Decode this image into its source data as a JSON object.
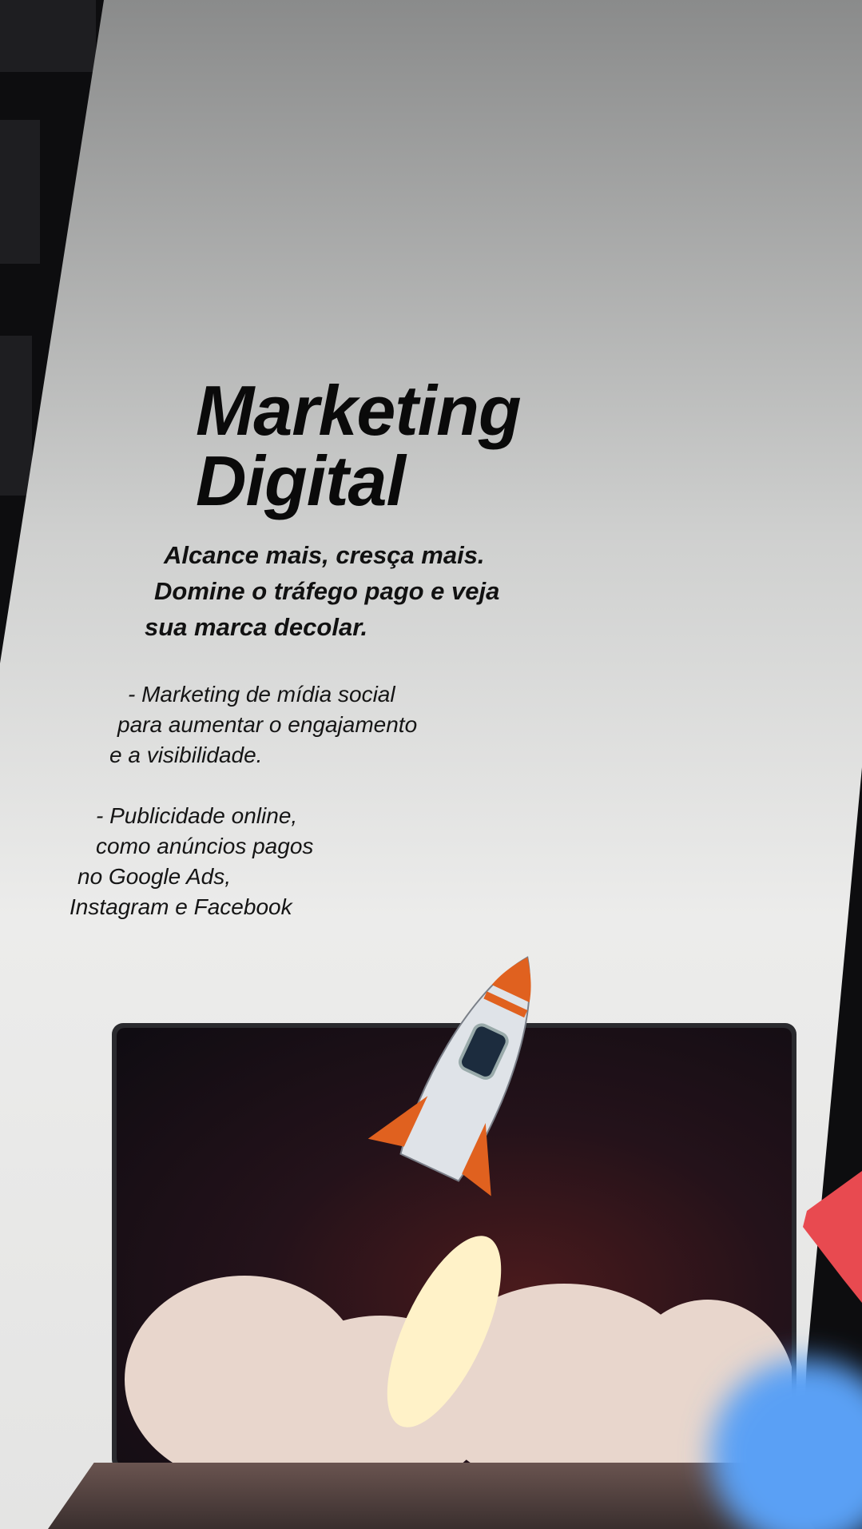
{
  "title": {
    "line1": "Marketing",
    "line2": "Digital"
  },
  "subtitle": {
    "line1": "Alcance mais, cresça mais.",
    "line2": "Domine o tráfego pago e veja",
    "line3": "sua marca decolar."
  },
  "bullets": [
    {
      "lines": [
        "- Marketing de mídia social",
        "para aumentar o engajamento",
        "e a visibilidade."
      ]
    },
    {
      "lines": [
        "- Publicidade online,",
        "como anúncios pagos",
        "no Google Ads,",
        "Instagram e Facebook"
      ]
    }
  ],
  "colors": {
    "paper": "#e9e9e9",
    "text": "#0a0a0a",
    "background": "#0d0d0f",
    "rocket_accent": "#e0611f",
    "badge": "#e84a50",
    "blob": "#5aa0f5"
  }
}
